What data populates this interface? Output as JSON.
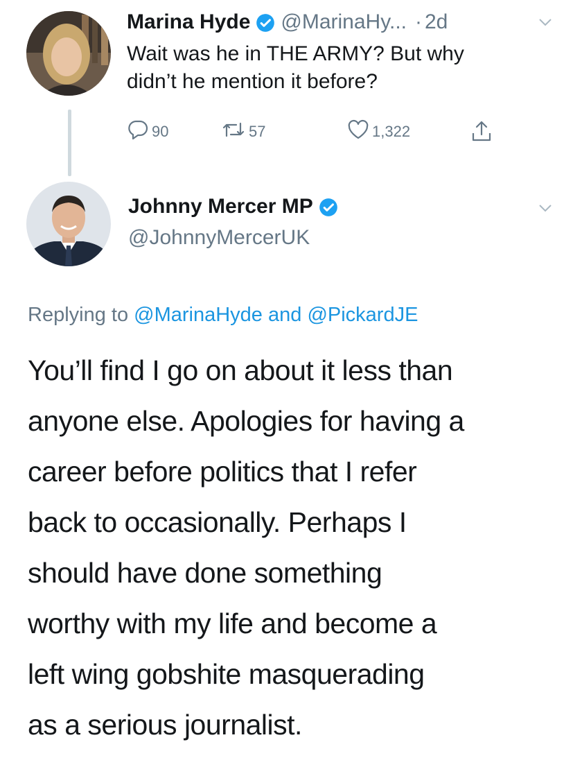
{
  "tweet1": {
    "name": "Marina Hyde",
    "handle": "@MarinaHy...",
    "separator": "·",
    "time": "2d",
    "text_lines": [
      "Wait was he in THE ARMY? But why",
      "didn’t he mention it before?"
    ],
    "reply_count": "90",
    "retweet_count": "57",
    "like_count": "1,322"
  },
  "tweet2": {
    "name": "Johnny Mercer MP",
    "handle": "@JohnnyMercerUK",
    "replying_prefix": "Replying to",
    "mention1": "@MarinaHyde",
    "replying_and": "and",
    "mention2": "@PickardJE",
    "text_lines": [
      "You’ll find I go on about it less than",
      "anyone else. Apologies for having a",
      "career before politics that I refer",
      "back to occasionally. Perhaps I",
      "should have done something",
      "worthy with my life and become a",
      "left wing gobshite masquerading",
      "as a serious journalist."
    ]
  },
  "colors": {
    "text": "#14171a",
    "secondary": "#657786",
    "link": "#1b95e0",
    "verified": "#1da1f2",
    "thread_line": "#cfd9de"
  },
  "icons": {
    "verified": "verified-badge-icon",
    "reply": "reply-icon",
    "retweet": "retweet-icon",
    "like": "heart-icon",
    "share": "share-icon",
    "caret": "chevron-down-icon"
  }
}
